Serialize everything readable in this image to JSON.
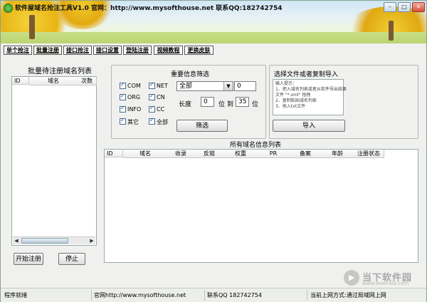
{
  "window": {
    "title": "软件屋域名抢注工具V1.0 官网：http://www.mysofthouse.net 联系QQ:182742754",
    "buttons": {
      "minimize": "–",
      "maximize": "□",
      "close": "✕"
    }
  },
  "tabs": [
    {
      "label": "单个抢注"
    },
    {
      "label": "批量注册",
      "active": true
    },
    {
      "label": "接口抢注"
    },
    {
      "label": "接口设置"
    },
    {
      "label": "登陆注册"
    },
    {
      "label": "视频教程"
    },
    {
      "label": "更换皮肤"
    }
  ],
  "batch_list": {
    "title": "批量待注册域名列表",
    "columns": [
      "ID",
      "域名",
      "次数"
    ],
    "scroll": {
      "left": "◀",
      "right": "▶"
    }
  },
  "buttons": {
    "start": "开始注册",
    "stop": "停止"
  },
  "filter": {
    "title": "重要信息筛选",
    "checkboxes": [
      {
        "label": "COM",
        "checked": true
      },
      {
        "label": "NET",
        "checked": true
      },
      {
        "label": "ORG",
        "checked": true
      },
      {
        "label": "CN",
        "checked": true
      },
      {
        "label": "INFO",
        "checked": true
      },
      {
        "label": "CC",
        "checked": true
      },
      {
        "label": "其它",
        "checked": true
      },
      {
        "label": "全部",
        "checked": true
      }
    ],
    "select_value": "全部",
    "count_value": "0",
    "length_label": "长度",
    "length_from": "0",
    "unit_label": "位",
    "to_label": "到",
    "length_to": "35",
    "unit_label_2": "位",
    "filter_button": "筛选"
  },
  "import": {
    "title": "选择文件或者复制导入",
    "memo_lines": [
      "输入提示：",
      "1、把入域名列表或者从软件导出结果",
      "文件 \"*.xml\" 拖拽",
      "2、复制粘贴域名列表",
      "3、拖入txt文件"
    ],
    "button": "导入"
  },
  "all_list": {
    "title": "所有域名信息列表",
    "columns": [
      "ID",
      "域名",
      "收录",
      "反链",
      "权重",
      "PR",
      "备案",
      "年龄",
      "注册状态"
    ]
  },
  "status": {
    "ready": "程序就绪",
    "site": "官网http://www.mysofthouse.net",
    "qq": "联系QQ 182742754",
    "network": "当前上网方式:通过局域网上网"
  },
  "watermark": {
    "text": "当下软件园",
    "url": "www.downxia.com"
  },
  "colors": {
    "accent": "#1b4e9b",
    "close": "#d7503a"
  }
}
